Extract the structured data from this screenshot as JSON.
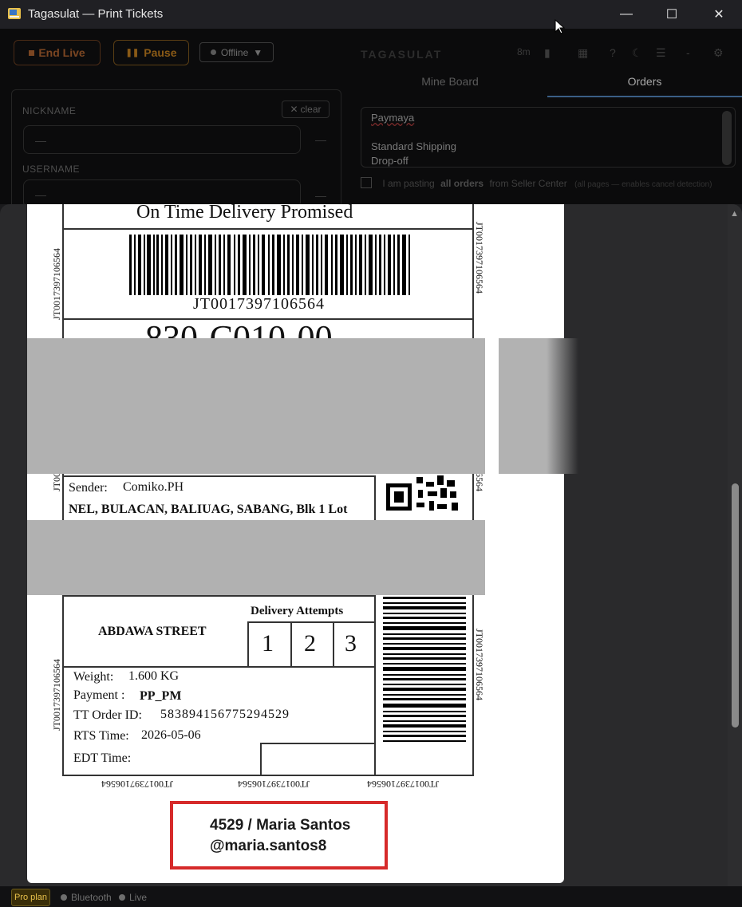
{
  "window": {
    "title": "Tagasulat — Print Tickets",
    "minimize": "—",
    "maximize": "☐",
    "close": "✕"
  },
  "background_app": {
    "end_live_label": "End Live",
    "pause_label": "Pause",
    "status_select": "Offline",
    "nickname_label": "NICKNAME",
    "nickname_value": "—",
    "username_label": "USERNAME",
    "username_value": "—",
    "clear_label": "clear",
    "brand": "TAGASULAT",
    "header_time": "8m",
    "tabs": [
      "Mine Board",
      "Orders"
    ],
    "notes": [
      "Paymaya",
      "",
      "Standard Shipping",
      "Drop-off"
    ],
    "paste_prefix": "I am pasting",
    "paste_bold": "all orders",
    "paste_suffix": "from Seller Center",
    "paste_hint": "(all pages — enables cancel detection)"
  },
  "ticket": {
    "promise": "On Time Delivery Promised",
    "tracking_no": "JT0017397106564",
    "sort_code_partial": "830-C010-00",
    "sender_label": "Sender:",
    "sender_name": "Comiko.PH",
    "sender_address": "NEL, BULACAN, BALIUAG, SABANG, Blk 1 Lot",
    "street": "ABDAWA STREET",
    "attempts_label": "Delivery Attempts",
    "attempts": [
      "1",
      "2",
      "3"
    ],
    "weight_label": "Weight:",
    "weight_value": "1.600 KG",
    "payment_label": "Payment :",
    "payment_value": "PP_PM",
    "tt_order_label": "TT Order ID:",
    "tt_order_value": "583894156775294529",
    "rts_label": "RTS Time:",
    "rts_value": "2026-05-06",
    "edt_label": "EDT Time:",
    "side_code": "JT0017397106564",
    "order_line": "4529 / Maria Santos",
    "handle_line": "@maria.santos8"
  },
  "statusbar": {
    "plan": "Pro plan",
    "bluetooth": "Bluetooth",
    "live": "Live"
  },
  "colors": {
    "highlight": "#d62a2a",
    "accent_tab": "#3a5f86",
    "plan_gold": "#e8c14b"
  }
}
